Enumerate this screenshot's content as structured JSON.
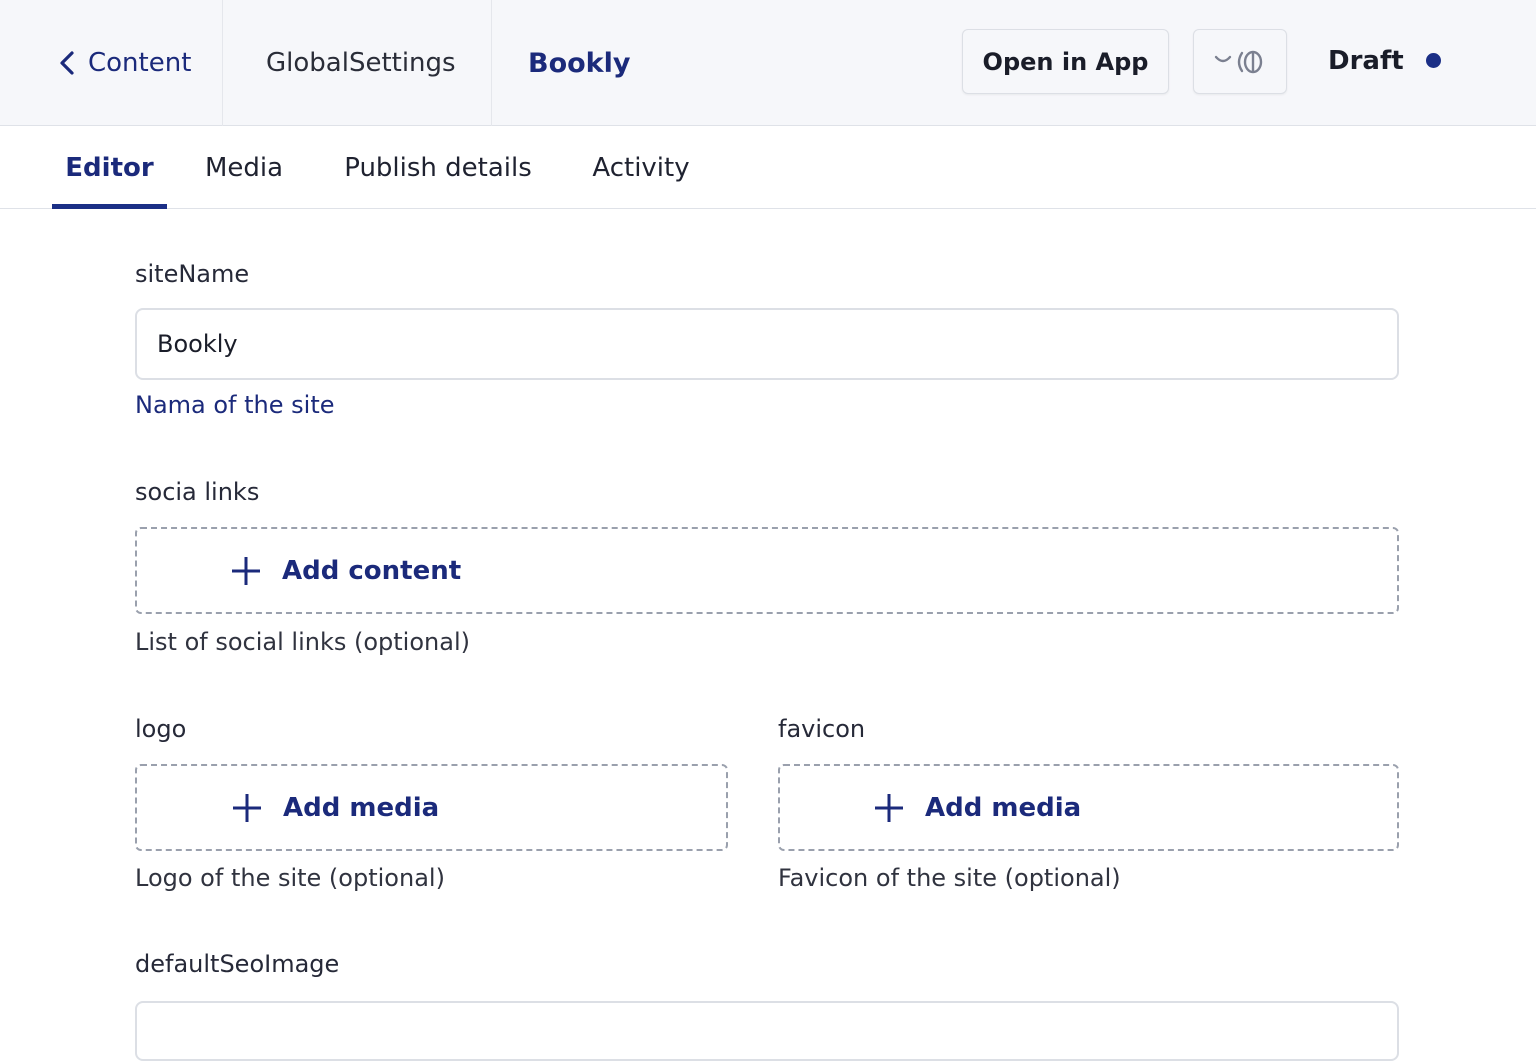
{
  "header": {
    "back_label": "Content",
    "document_type": "GlobalSettings",
    "document_title": "Bookly",
    "open_in_app_label": "Open in App",
    "view_toggle_icon": "eye-split-icon",
    "status_label": "Draft",
    "status_color": "#1b2f86"
  },
  "tabs": [
    {
      "label": "Editor",
      "active": true
    },
    {
      "label": "Media",
      "active": false
    },
    {
      "label": "Publish details",
      "active": false
    },
    {
      "label": "Activity",
      "active": false
    }
  ],
  "form": {
    "site_name": {
      "label": "siteName",
      "value": "Bookly",
      "help": "Nama of the site"
    },
    "social_links": {
      "label": "socia links",
      "action_label": "Add content",
      "help": "List of social links (optional)"
    },
    "logo": {
      "label": "logo",
      "action_label": "Add media",
      "help": "Logo of the site (optional)"
    },
    "favicon": {
      "label": "favicon",
      "action_label": "Add media",
      "help": "Favicon of the site (optional)"
    },
    "default_seo_image": {
      "label": "defaultSeoImage"
    }
  },
  "colors": {
    "accent": "#1b2a7b",
    "border": "#dcdfe5",
    "header_bg": "#f6f7fa"
  }
}
